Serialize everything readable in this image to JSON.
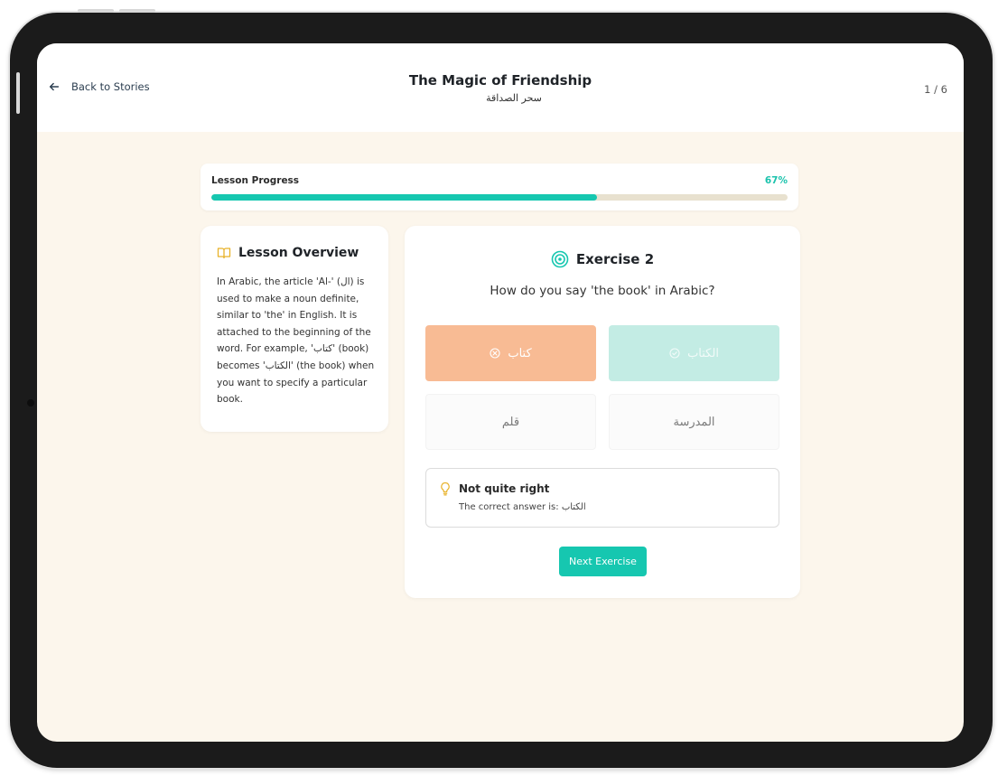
{
  "header": {
    "back_label": "Back to Stories",
    "title": "The Magic of Friendship",
    "subtitle_arabic": "سحر الصداقة",
    "page_counter": "1 / 6"
  },
  "progress": {
    "label": "Lesson Progress",
    "percent_text": "67%",
    "value": 0.67,
    "fill_color": "#16c7b0"
  },
  "overview": {
    "title": "Lesson Overview",
    "icon": "book-icon",
    "text": "In Arabic, the article 'Al-' (ال) is used to make a noun definite, similar to 'the' in English. It is attached to the beginning of the word. For example, 'كتاب' (book) becomes 'الكتاب' (the book) when you want to specify a particular book."
  },
  "exercise": {
    "title": "Exercise 2",
    "icon": "target-icon",
    "question": "How do you say 'the book' in Arabic?",
    "options": [
      {
        "label": "كتاب",
        "state": "selected-wrong",
        "color": "#f8bb94",
        "icon": "x-circle-icon"
      },
      {
        "label": "الكتاب",
        "state": "correct",
        "color": "#c3ece4",
        "icon": "check-circle-icon"
      },
      {
        "label": "قلم",
        "state": "neutral"
      },
      {
        "label": "المدرسة",
        "state": "neutral"
      }
    ],
    "feedback": {
      "icon": "lightbulb-icon",
      "title": "Not quite right",
      "text_prefix": "The correct answer is:",
      "answer": "الكتاب"
    },
    "next_button": "Next Exercise"
  },
  "colors": {
    "accent": "#16c7b0",
    "page_background": "#fcf6ec",
    "wrong": "#f8bb94",
    "correct": "#c3ece4"
  }
}
